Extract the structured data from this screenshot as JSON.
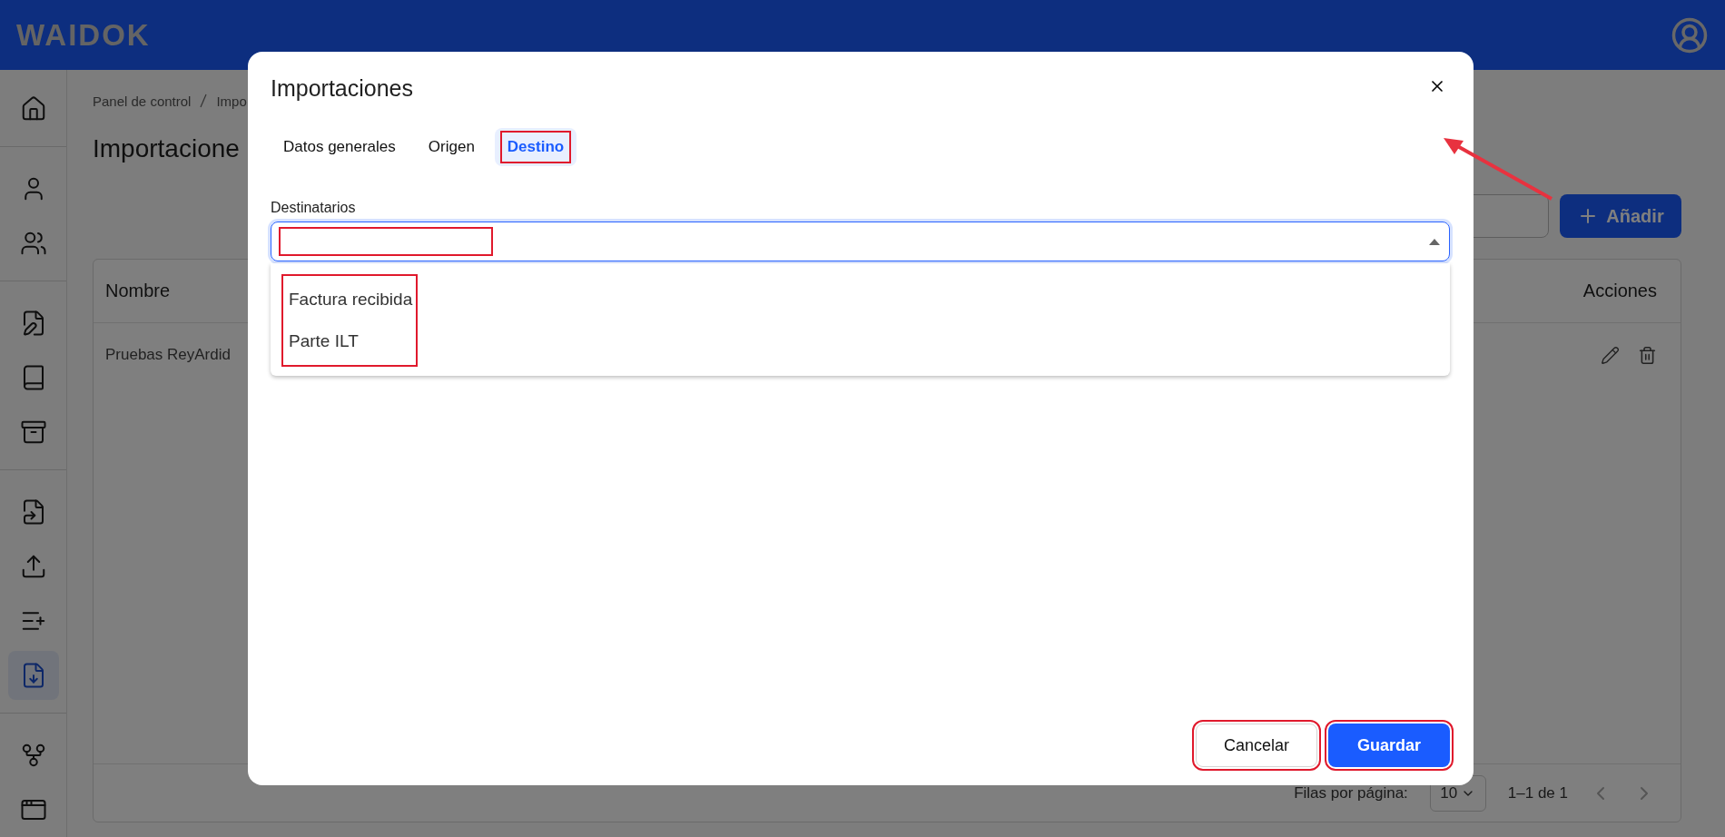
{
  "header": {
    "logo": "WAIDOK"
  },
  "sidebar": {
    "groups": [
      [
        {
          "selected": false
        }
      ],
      [
        {
          "selected": false
        },
        {
          "selected": false
        }
      ],
      [
        {
          "selected": false
        },
        {
          "selected": false
        },
        {
          "selected": false
        }
      ],
      [
        {
          "selected": false
        },
        {
          "selected": false
        },
        {
          "selected": false
        },
        {
          "selected": true
        }
      ],
      [
        {
          "selected": false
        },
        {
          "selected": false
        }
      ]
    ]
  },
  "page": {
    "breadcrumb": [
      "Panel de control",
      "Impo"
    ],
    "title": "Importacione",
    "add_button": "Añadir",
    "table": {
      "columns": [
        "Nombre",
        "Acciones"
      ],
      "rows": [
        {
          "nombre": "Pruebas ReyArdid"
        }
      ]
    },
    "footer": {
      "rows_per_page_label": "Filas por página:",
      "rows_per_page": "10",
      "range": "1–1 de 1"
    }
  },
  "dialog": {
    "title": "Importaciones",
    "tabs": [
      {
        "label": "Datos generales",
        "selected": false,
        "highlighted": false
      },
      {
        "label": "Origen",
        "selected": false,
        "highlighted": false
      },
      {
        "label": "Destino",
        "selected": true,
        "highlighted": true
      }
    ],
    "field": {
      "label": "Destinatarios",
      "expanded": true,
      "highlighted": true
    },
    "options_highlighted": true,
    "options": [
      "Factura recibida",
      "Parte ILT"
    ],
    "buttons": [
      {
        "kind": "secondary",
        "label": "Cancelar",
        "highlighted": true
      },
      {
        "kind": "primary",
        "label": "Guardar",
        "highlighted": true
      }
    ]
  },
  "annotation_arrow": true
}
